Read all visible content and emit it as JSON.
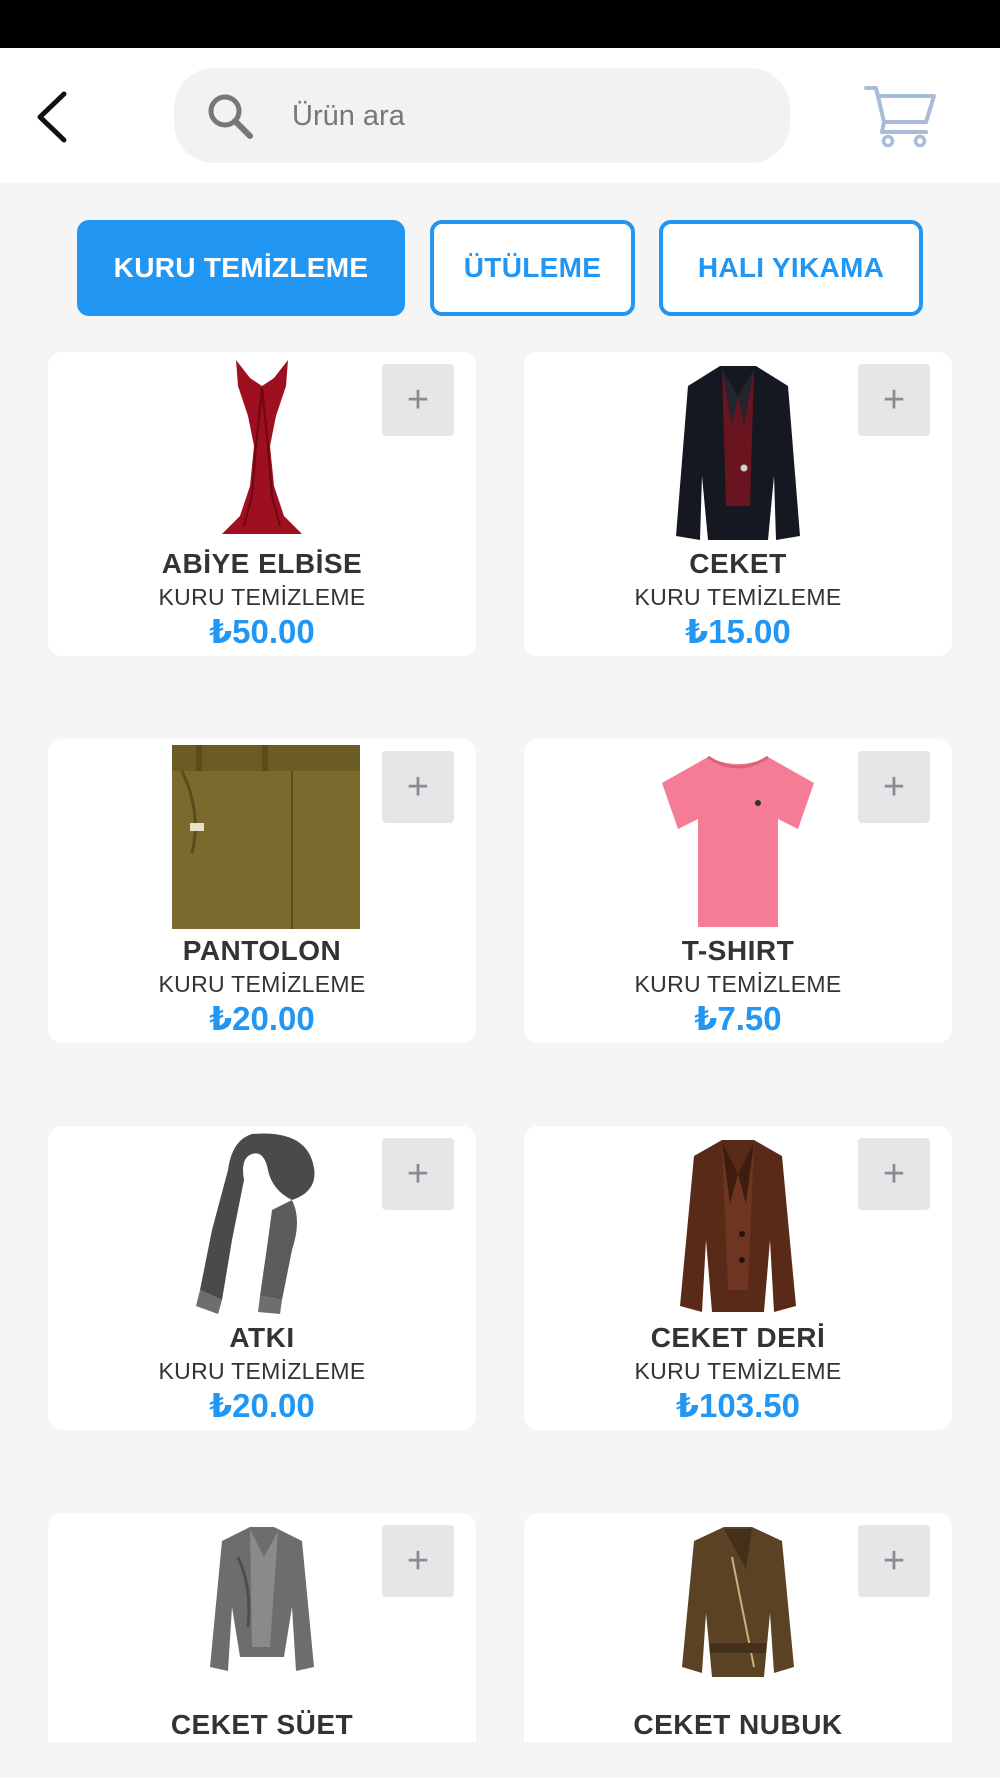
{
  "search": {
    "placeholder": "Ürün ara"
  },
  "tabs": [
    {
      "label": "KURU TEMİZLEME",
      "active": true
    },
    {
      "label": "ÜTÜLEME",
      "active": false
    },
    {
      "label": "HALI YIKAMA",
      "active": false
    }
  ],
  "add_label": "+",
  "products": [
    {
      "name": "ABİYE ELBİSE",
      "category": "KURU TEMİZLEME",
      "price": "₺50.00",
      "image": "evening-dress"
    },
    {
      "name": "CEKET",
      "category": "KURU TEMİZLEME",
      "price": "₺15.00",
      "image": "blazer"
    },
    {
      "name": "PANTOLON",
      "category": "KURU TEMİZLEME",
      "price": "₺20.00",
      "image": "trousers"
    },
    {
      "name": "T-SHIRT",
      "category": "KURU TEMİZLEME",
      "price": "₺7.50",
      "image": "t-shirt"
    },
    {
      "name": "ATKI",
      "category": "KURU TEMİZLEME",
      "price": "₺20.00",
      "image": "scarf"
    },
    {
      "name": "CEKET DERİ",
      "category": "KURU TEMİZLEME",
      "price": "₺103.50",
      "image": "leather-jacket"
    },
    {
      "name": "CEKET SÜET",
      "category": "",
      "price": "",
      "image": "suede-jacket"
    },
    {
      "name": "CEKET NUBUK",
      "category": "",
      "price": "",
      "image": "nubuck-jacket"
    }
  ],
  "colors": {
    "accent": "#2196f3",
    "background": "#f5f5f5",
    "status_bar": "#000000"
  }
}
